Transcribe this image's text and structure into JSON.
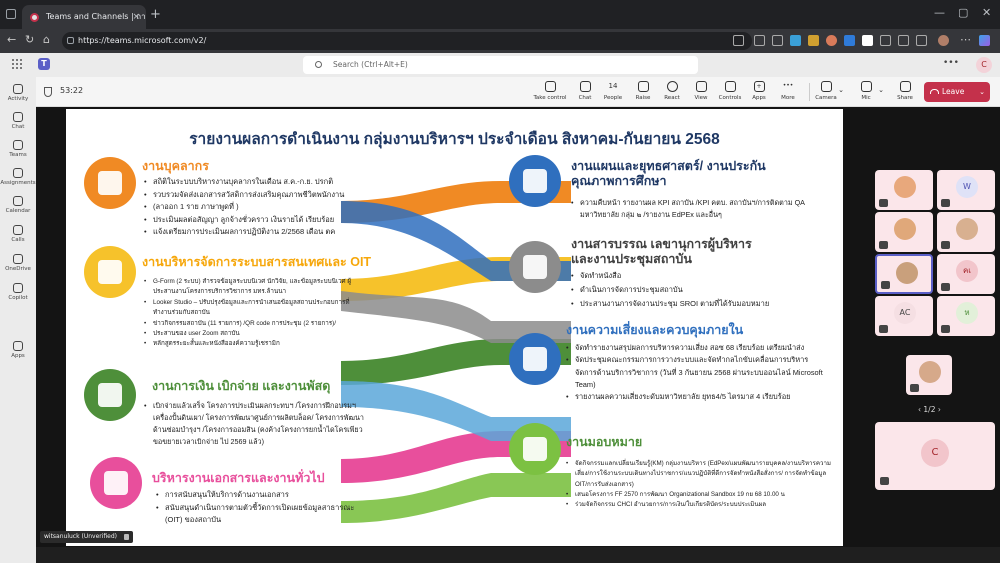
{
  "browser": {
    "tab_title": "Teams and Channels | การประ",
    "url": "https://teams.microsoft.com/v2/"
  },
  "teams": {
    "search_placeholder": "Search (Ctrl+Alt+E)",
    "user_initial": "C",
    "rail": [
      "Activity",
      "Chat",
      "Teams",
      "Assignments",
      "Calendar",
      "Calls",
      "OneDrive",
      "Copilot",
      "Apps"
    ]
  },
  "meeting": {
    "timer": "53:22",
    "people_count": "14",
    "tools": [
      "Take control",
      "Chat",
      "People",
      "Raise",
      "React",
      "View",
      "Controls",
      "Apps",
      "More",
      "Camera",
      "Mic",
      "Share"
    ],
    "leave_label": "Leave",
    "page_indicator": "1/2",
    "presenter_name": "witsanuluck (Unverified)",
    "participants": [
      {
        "initials": "",
        "color": "#e8a87c"
      },
      {
        "initials": "W",
        "color": "#dfe2f7"
      },
      {
        "initials": "",
        "color": "#e0a87a"
      },
      {
        "initials": "",
        "color": "#d8b090"
      },
      {
        "initials": "",
        "color": "#c9a07c"
      },
      {
        "initials": "คเ",
        "color": "#f2c5cb"
      },
      {
        "initials": "AC",
        "color": "#f5dfe3"
      },
      {
        "initials": "ห",
        "color": "#e2f0d9"
      },
      {
        "initials": "",
        "color": "#d6a98a"
      }
    ],
    "big_participant": "C"
  },
  "slide": {
    "title": "รายงานผลการดำเนินงาน กลุ่มงานบริหารฯ ประจำเดือน สิงหาคม-กันยายน 2568",
    "colors": {
      "orange": "#f08a24",
      "yellow": "#f6c22b",
      "green": "#4e8f3a",
      "pink": "#e84f9c",
      "blue": "#2f6fbe",
      "gray": "#8c8c8c",
      "lightgreen": "#7cc142"
    },
    "left": [
      {
        "title": "งานบุคลากร",
        "icon": "briefcase-icon",
        "color": "#f08a24",
        "bullets": [
          "สถิติในระบบบริหารงานบุคลากรในเดือน ส.ค.-ก.ย. ปรกติ",
          "รวบรวมจัดส่งเอกสารสวัสดิการส่งเสริมคุณภาพชีวิตพนักงาน",
          "(ลาออก 1 ราย ภาษาพูดที่ )",
          "ประเมินผลต่อสัญญา ลูกจ้างชั่วคราว เงินรายได้ เรียบร้อย",
          "แจ้งเตรียมการประเมินผลการปฏิบัติงาน 2/2568 เดือน ตค"
        ]
      },
      {
        "title": "งานบริหารจัดการระบบสารสนเทศและ OIT",
        "icon": "pie-chart-icon",
        "color": "#f6c22b",
        "bullets": [
          "G-Form (2 ระบบ) สำรวจข้อมูลระบบนิเวศ นักวิจัย, และข้อมูลระบบนิเวศ ผู้ประสานงานโครงการบริการวิชาการ มทร.ล้านนา",
          "Looker Studio – ปรับปรุงข้อมูลและการนำเสนอข้อมูลสถานประกอบการที่ทำงานร่วมกับสถาบัน",
          "ข่าวกิจกรรมสถาบัน (11 รายการ) /QR code การประชุม (2 รายการ)/",
          "ประสานของ user Zoom สถาบัน",
          "หลักสูตรระยะสั้นและหนังสือองค์ความรู้เชรามิก"
        ]
      },
      {
        "title": "งานการเงิน เบิกจ่าย และงานพัสดุ",
        "icon": "piggy-bank-icon",
        "color": "#4e8f3a",
        "bullets": [
          "เบิกจ่ายแล้วเสร็จ โครงการประเมินผลกระทบฯ /โครงการฝึกอบรมฯ เครื่องปั้นดินเผา/ โครงการพัฒนาศูนย์การผลิตบล็อค/ โครงการพัฒนาด้านซ่อมบำรุงฯ /โครงการออมสิน (คงค้างโครงการยกน้ำไดโครเพียว ขอขยายเวลาเบิกจ่าย ไป 2569 แล้ว)"
        ]
      },
      {
        "title": "บริหารงานเอกสารและงานทั่วไป",
        "icon": "document-tray-icon",
        "color": "#e84f9c",
        "bullets": [
          "การสนับสนุนให้บริการด้านงานเอกสาร",
          "สนับสนุนดำเนินการตามตัวชี้วัดการเปิดเผยข้อมูลสาธารณะ (OIT) ของสถาบัน"
        ]
      }
    ],
    "right": [
      {
        "title": "งานแผนและยุทธศาสตร์/ งานประกันคุณภาพการศึกษา",
        "icon": "clipboard-icon",
        "color": "#2f6fbe",
        "bullets": [
          "ความคืบหน้า รายงานผล KPI สถาบัน /KPI คตบ. สถาบันฯ/การติดตาม QA มหาวิทยาลัย กลุ่ม ๒ /รายงาน EdPEx และอื่นๆ"
        ]
      },
      {
        "title": "งานสารบรรณ เลขานุการผู้บริหาร และงานประชุมสถาบัน",
        "icon": "presentation-icon",
        "color": "#8c8c8c",
        "bullets": [
          "จัดทำหนังสือ",
          "ดำเนินการจัดการประชุมสถาบัน",
          "ประสานงานการจัดงานประชุม SROI ตามที่ได้รับมอบหมาย"
        ]
      },
      {
        "title": "งานความเสี่ยงและควบคุมภายใน",
        "icon": "coins-icon",
        "color": "#2f6fbe",
        "bullets": [
          "จัดทำรายงานสรุปผลการบริหารความเสี่ยง สอซ 68 เรียบร้อย เตรียมนำส่ง",
          "จัดประชุมคณะกรรมการการวางระบบและจัดทำกลไกขับเคลื่อนการบริหารจัดการด้านบริการวิชาการ (วันที่ 3 กันยายน 2568 ผ่านระบบออนไลน์ Microsoft Team)",
          "รายงานผลความเสี่ยงระดับมหาวิทยาลัย ยุทธ4/5 ไตรมาส 4 เรียบร้อย"
        ]
      },
      {
        "title": "งานมอบหมาย",
        "icon": "institution-icon",
        "color": "#7cc142",
        "bullets": [
          "จัดกิจกรรมแลกเปลี่ยนเรียนรู้(KM) กลุ่มงานบริหาร (EdPex/แผนพัฒนารายบุคคล/งานบริหารความเสี่ยง/การใช้งานระบบเดินทางไปราชการ/แนวปฏิบัติที่ดีการจัดทำหนังสือสั่งการ/ การจัดทำข้อมูล OIT/การรับส่งเอกสาร)",
          "เสนอโครงการ FF 2570 การพัฒนา Organizational Sandbox 19 กย 68 10.00 น",
          "ร่วมจัดกิจกรรม CHCI อำนวยการ/การเงิน/ใบเกียรติบัตร/ระบบประเมินผล"
        ]
      }
    ]
  }
}
